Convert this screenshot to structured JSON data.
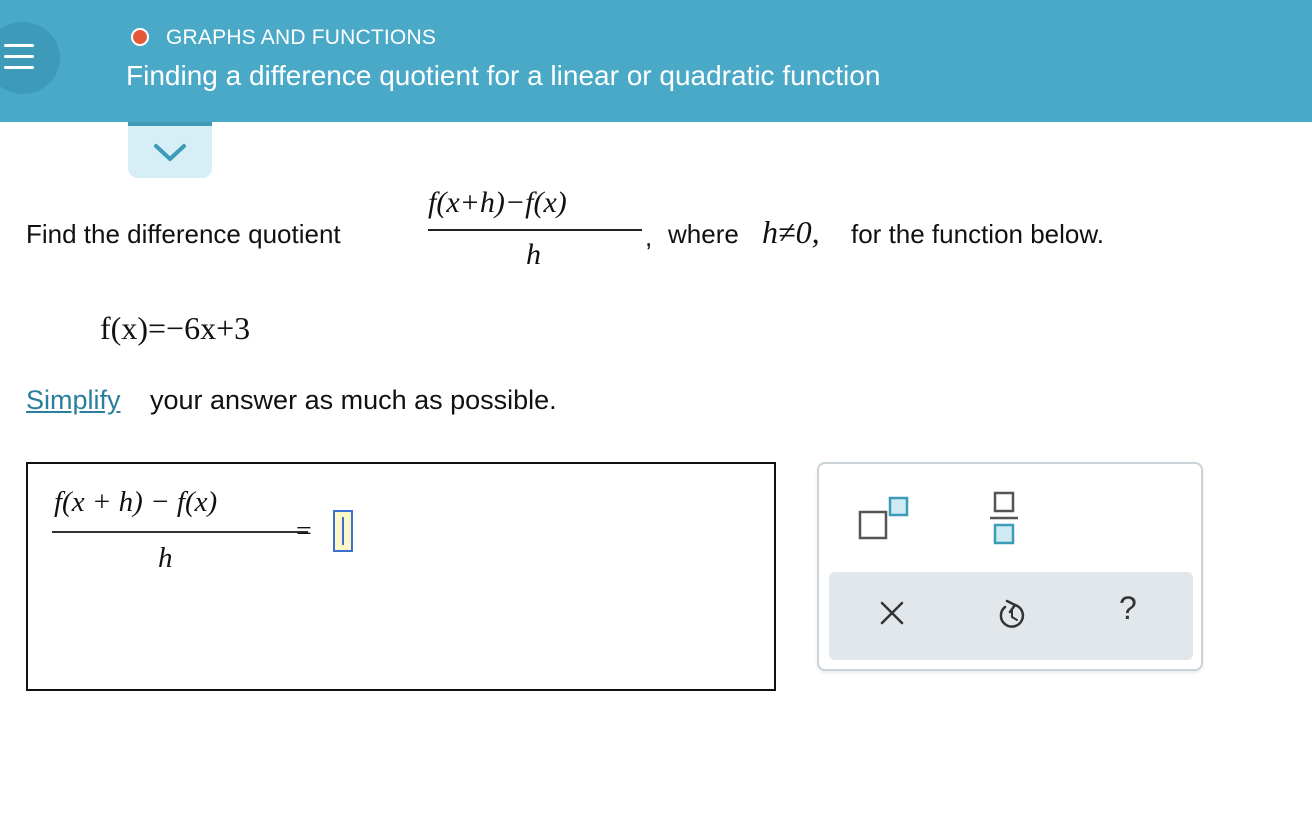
{
  "header": {
    "topic": "GRAPHS AND FUNCTIONS",
    "title": "Finding a difference quotient for a linear or quadratic function",
    "accent_color": "#4aa9c7",
    "status_dot_color": "#e5593a"
  },
  "question": {
    "prefix": "Find the difference quotient",
    "numerator": "f(x+h)−f(x)",
    "denominator": "h",
    "suffix_comma": ",",
    "where_text": "where",
    "condition": "h≠0,",
    "suffix": "for the function below.",
    "function": "f(x)=−6x+3",
    "simplify_link": "Simplify",
    "simplify_rest": "your answer as much as possible."
  },
  "answer": {
    "numerator": "f(x + h) − f(x)",
    "denominator": "h",
    "equals": "=",
    "input_value": ""
  },
  "toolbox": {
    "exponent_icon": "superscript-template-icon",
    "fraction_icon": "fraction-template-icon",
    "clear_icon": "close-icon",
    "undo_icon": "undo-icon",
    "help_label": "?"
  }
}
